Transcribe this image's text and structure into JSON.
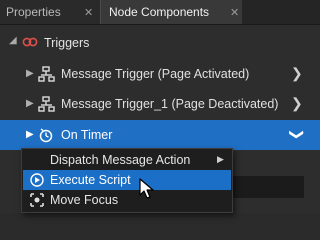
{
  "tabs": [
    {
      "label": "Properties",
      "active": false
    },
    {
      "label": "Node Components",
      "active": true
    }
  ],
  "tree": {
    "triggers_label": "Triggers",
    "items": [
      {
        "label": "Message Trigger (Page Activated)",
        "icon": "message-trigger-icon",
        "selected": false
      },
      {
        "label": "Message Trigger_1 (Page Deactivated)",
        "icon": "message-trigger-icon",
        "selected": false
      },
      {
        "label": "On Timer",
        "icon": "timer-icon",
        "selected": true
      }
    ]
  },
  "context_menu": {
    "items": [
      {
        "label": "Dispatch Message Action",
        "has_submenu": true,
        "icon": ""
      },
      {
        "label": "Execute Script",
        "has_submenu": false,
        "icon": "script-icon",
        "highlighted": true
      },
      {
        "label": "Move Focus",
        "has_submenu": false,
        "icon": "move-focus-icon"
      }
    ]
  },
  "colors": {
    "selection": "#1f6fc4",
    "background": "#2d2d2d",
    "trigger_icon": "#e0504a"
  }
}
